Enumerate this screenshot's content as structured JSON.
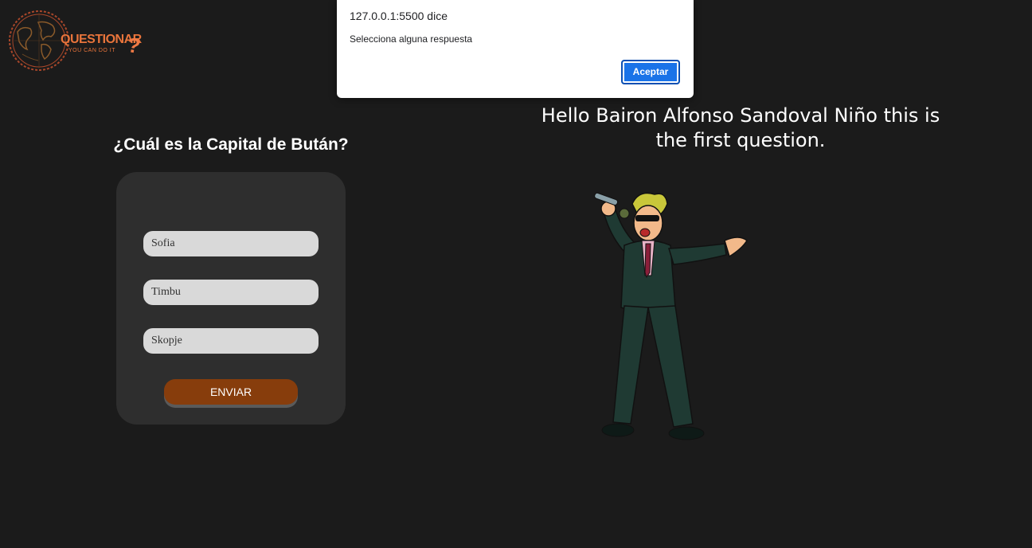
{
  "logo": {
    "title": "QUESTIONAR",
    "tagline": "YOU CAN DO IT",
    "mark": "?",
    "accent_color": "#e8743b",
    "icon": "globe-icon"
  },
  "quiz": {
    "question": "¿Cuál es la Capital de Bután?",
    "options": [
      "Sofia",
      "Timbu",
      "Skopje"
    ],
    "submit_label": "ENVIAR",
    "submit_color": "#873d0c"
  },
  "greeting": {
    "text": "Hello Bairon Alfonso Sandoval Niño this is the first question."
  },
  "character": {
    "icon": "singing-man-illustration"
  },
  "alert": {
    "origin": "127.0.0.1:5500 dice",
    "message": "Selecciona alguna respuesta",
    "ok_label": "Aceptar",
    "button_color": "#1a73e8"
  }
}
